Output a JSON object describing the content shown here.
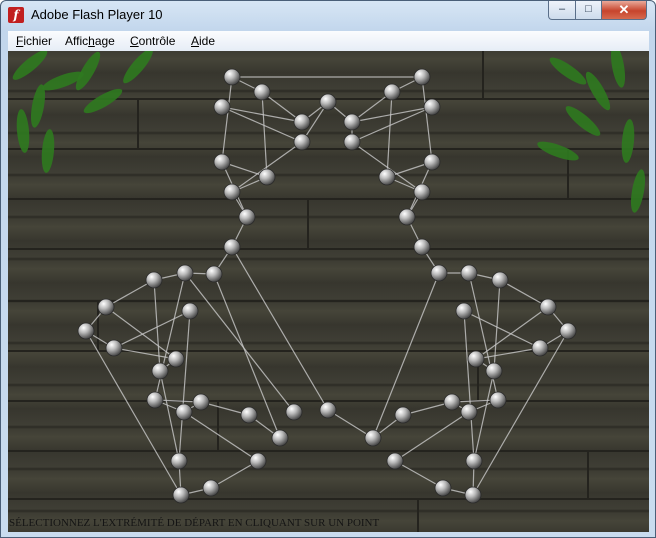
{
  "window": {
    "title": "Adobe Flash Player 10",
    "controls": {
      "minimize": "–",
      "maximize": "□",
      "close": "✕"
    }
  },
  "menu": {
    "items": [
      {
        "id": "fichier",
        "before": "",
        "accel": "F",
        "after": "ichier"
      },
      {
        "id": "affichage",
        "before": "Affic",
        "accel": "h",
        "after": "age"
      },
      {
        "id": "controle",
        "before": "",
        "accel": "C",
        "after": "ontrôle"
      },
      {
        "id": "aide",
        "before": "",
        "accel": "A",
        "after": "ide"
      }
    ]
  },
  "game": {
    "status_text": "SÉLECTIONNEZ L'EXTRÉMITÉ DE DÉPART EN CLIQUANT SUR UN POINT",
    "colors": {
      "wood": "#3d3c33",
      "line": "#c9c9c9",
      "pin": "#b9b9b9",
      "leaf": "#2f7a1f"
    }
  }
}
